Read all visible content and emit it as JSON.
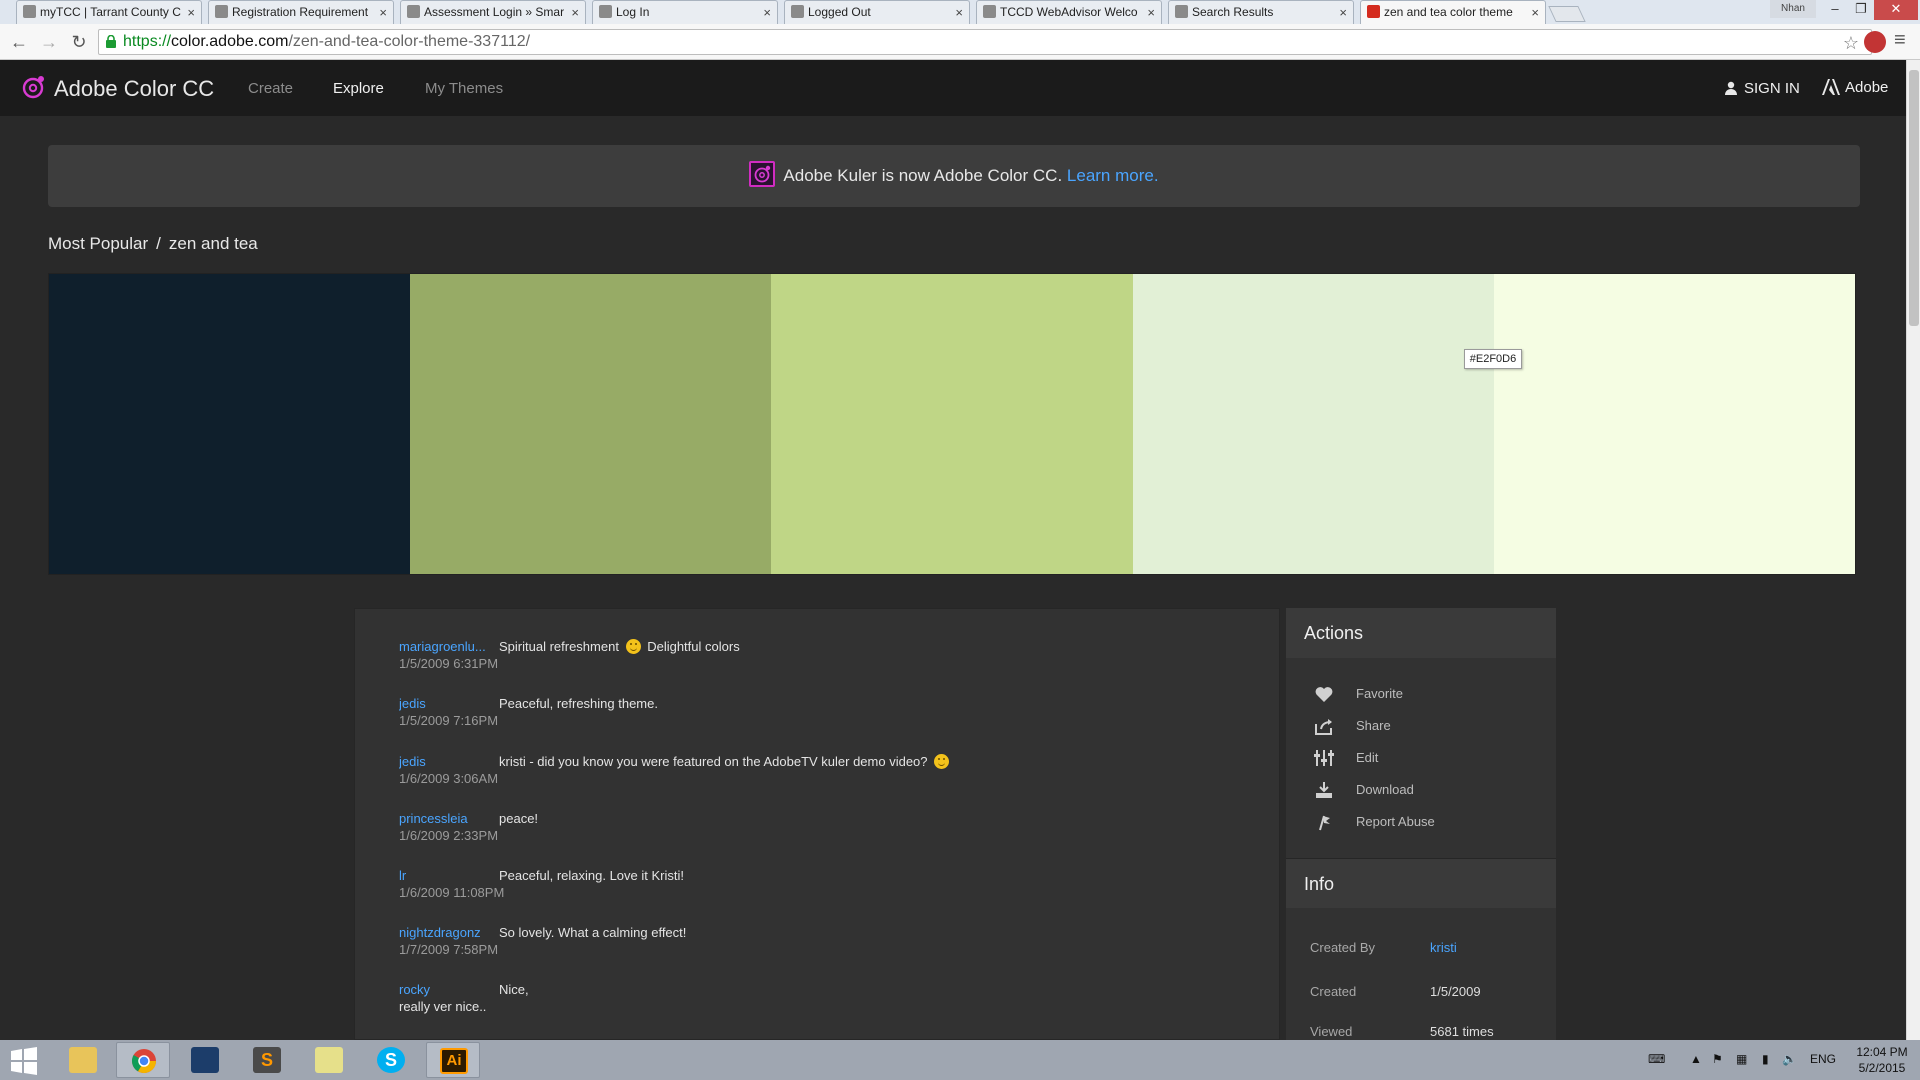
{
  "browser": {
    "user_badge": "Nhan",
    "tabs": [
      {
        "title": "myTCC | Tarrant County C",
        "close": "×"
      },
      {
        "title": "Registration Requirement",
        "close": "×"
      },
      {
        "title": "Assessment Login » Smar",
        "close": "×"
      },
      {
        "title": "Log In",
        "close": "×"
      },
      {
        "title": "Logged Out",
        "close": "×"
      },
      {
        "title": "TCCD WebAdvisor Welco",
        "close": "×"
      },
      {
        "title": "Search Results",
        "close": "×"
      },
      {
        "title": "zen and tea color theme",
        "close": "×"
      }
    ],
    "url_scheme": "https://",
    "url_host": "color.adobe.com",
    "url_path": "/zen-and-tea-color-theme-337112/"
  },
  "site": {
    "brand": "Adobe Color CC",
    "nav": {
      "create": "Create",
      "explore": "Explore",
      "my_themes": "My Themes"
    },
    "sign_in": "SIGN IN",
    "adobe": "Adobe"
  },
  "banner": {
    "text": "Adobe Kuler is now Adobe Color CC.",
    "link": "Learn more."
  },
  "breadcrumb": {
    "parent": "Most Popular",
    "separator": "/",
    "current": "zen and tea"
  },
  "palette": {
    "colors": [
      "#0f1f2c",
      "#97ab66",
      "#bfd686",
      "#e2f0d6",
      "#f5fde3"
    ],
    "hover_hex": "#E2F0D6"
  },
  "comments": [
    {
      "user": "mariagroenlu...",
      "date": "1/5/2009 6:31PM",
      "text_a": "Spiritual refreshment",
      "emoji": true,
      "text_b": "Delightful colors"
    },
    {
      "user": "jedis",
      "date": "1/5/2009 7:16PM",
      "text_a": "Peaceful, refreshing theme."
    },
    {
      "user": "jedis",
      "date": "1/6/2009 3:06AM",
      "text_a": "kristi - did you know you were featured on the AdobeTV kuler demo video?",
      "emoji": true
    },
    {
      "user": "princessleia",
      "date": "1/6/2009 2:33PM",
      "text_a": "peace!"
    },
    {
      "user": "lr",
      "date": "1/6/2009 11:08PM",
      "text_a": "Peaceful, relaxing. Love it Kristi!"
    },
    {
      "user": "nightzdragonz",
      "date": "1/7/2009 7:58PM",
      "text_a": "So lovely. What a calming effect!"
    },
    {
      "user": "rocky",
      "text_a": "Nice,",
      "text_2": "really ver nice.."
    }
  ],
  "actions": {
    "title": "Actions",
    "favorite": "Favorite",
    "share": "Share",
    "edit": "Edit",
    "download": "Download",
    "report": "Report Abuse"
  },
  "info": {
    "title": "Info",
    "created_by_label": "Created By",
    "created_by": "kristi",
    "created_label": "Created",
    "created": "1/5/2009",
    "viewed_label": "Viewed",
    "viewed": "5681 times"
  },
  "taskbar": {
    "lang": "ENG",
    "time": "12:04 PM",
    "date": "5/2/2015",
    "illustrator_label": "Ai",
    "skype_label": "S",
    "sublime_label": "S"
  }
}
